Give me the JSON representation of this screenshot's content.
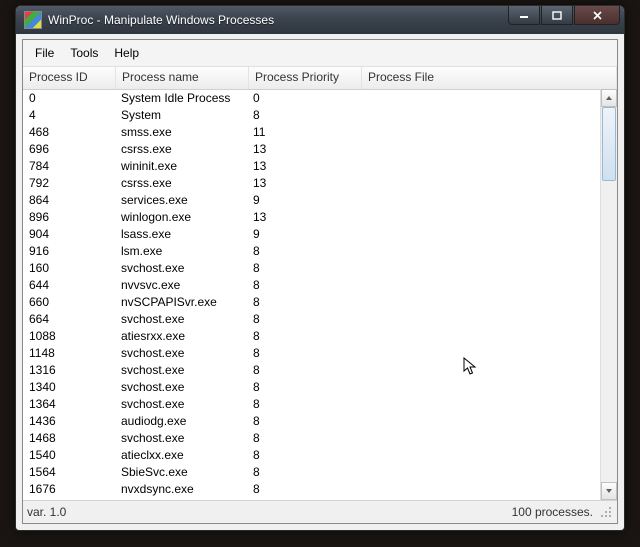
{
  "window": {
    "title": "WinProc - Manipulate Windows Processes"
  },
  "menu": {
    "file": "File",
    "tools": "Tools",
    "help": "Help"
  },
  "columns": {
    "pid": "Process ID",
    "name": "Process name",
    "priority": "Process Priority",
    "file": "Process File"
  },
  "rows": [
    {
      "pid": "0",
      "name": "System Idle Process",
      "priority": "0",
      "file": ""
    },
    {
      "pid": "4",
      "name": "System",
      "priority": "8",
      "file": ""
    },
    {
      "pid": "468",
      "name": "smss.exe",
      "priority": "11",
      "file": ""
    },
    {
      "pid": "696",
      "name": "csrss.exe",
      "priority": "13",
      "file": ""
    },
    {
      "pid": "784",
      "name": "wininit.exe",
      "priority": "13",
      "file": ""
    },
    {
      "pid": "792",
      "name": "csrss.exe",
      "priority": "13",
      "file": ""
    },
    {
      "pid": "864",
      "name": "services.exe",
      "priority": "9",
      "file": ""
    },
    {
      "pid": "896",
      "name": "winlogon.exe",
      "priority": "13",
      "file": ""
    },
    {
      "pid": "904",
      "name": "lsass.exe",
      "priority": "9",
      "file": ""
    },
    {
      "pid": "916",
      "name": "lsm.exe",
      "priority": "8",
      "file": ""
    },
    {
      "pid": "160",
      "name": "svchost.exe",
      "priority": "8",
      "file": ""
    },
    {
      "pid": "644",
      "name": "nvvsvc.exe",
      "priority": "8",
      "file": ""
    },
    {
      "pid": "660",
      "name": "nvSCPAPISvr.exe",
      "priority": "8",
      "file": ""
    },
    {
      "pid": "664",
      "name": "svchost.exe",
      "priority": "8",
      "file": ""
    },
    {
      "pid": "1088",
      "name": "atiesrxx.exe",
      "priority": "8",
      "file": ""
    },
    {
      "pid": "1148",
      "name": "svchost.exe",
      "priority": "8",
      "file": ""
    },
    {
      "pid": "1316",
      "name": "svchost.exe",
      "priority": "8",
      "file": ""
    },
    {
      "pid": "1340",
      "name": "svchost.exe",
      "priority": "8",
      "file": ""
    },
    {
      "pid": "1364",
      "name": "svchost.exe",
      "priority": "8",
      "file": ""
    },
    {
      "pid": "1436",
      "name": "audiodg.exe",
      "priority": "8",
      "file": ""
    },
    {
      "pid": "1468",
      "name": "svchost.exe",
      "priority": "8",
      "file": ""
    },
    {
      "pid": "1540",
      "name": "atieclxx.exe",
      "priority": "8",
      "file": ""
    },
    {
      "pid": "1564",
      "name": "SbieSvc.exe",
      "priority": "8",
      "file": ""
    },
    {
      "pid": "1676",
      "name": "nvxdsync.exe",
      "priority": "8",
      "file": ""
    }
  ],
  "status": {
    "version": "var. 1.0",
    "count": "100 processes."
  }
}
